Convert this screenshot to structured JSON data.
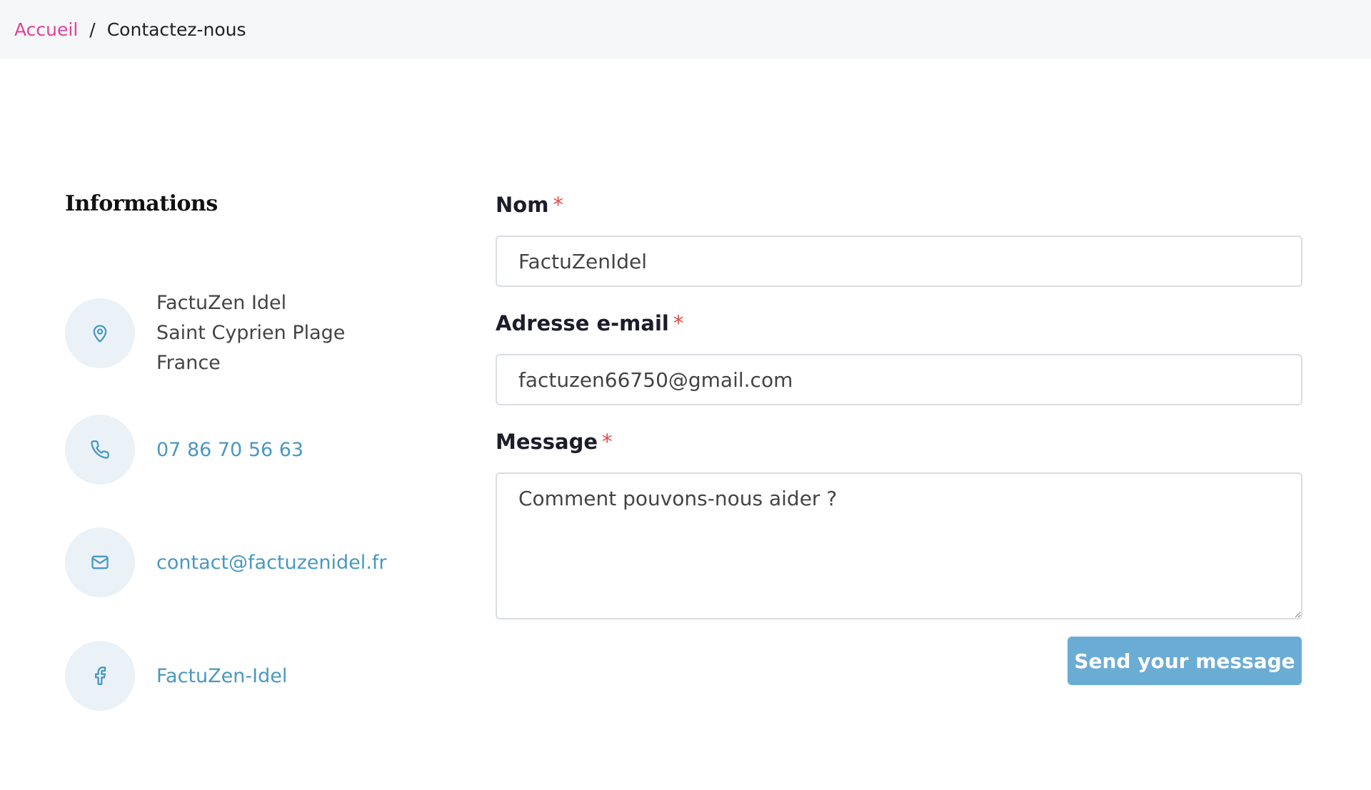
{
  "breadcrumb": {
    "home_label": "Accueil",
    "separator": "/",
    "current_label": "Contactez-nous"
  },
  "info": {
    "title": "Informations",
    "address": {
      "icon": "map-pin-icon",
      "lines": [
        "FactuZen Idel",
        "Saint Cyprien Plage",
        "France"
      ]
    },
    "phone": {
      "icon": "phone-icon",
      "label": "07 86 70 56 63"
    },
    "email": {
      "icon": "mail-icon",
      "label": "contact@factuzenidel.fr"
    },
    "facebook": {
      "icon": "facebook-icon",
      "label": "FactuZen-Idel"
    }
  },
  "form": {
    "required_mark": "*",
    "name": {
      "label": "Nom",
      "value": "FactuZenIdel"
    },
    "email": {
      "label": "Adresse e-mail",
      "value": "factuzen66750@gmail.com"
    },
    "message": {
      "label": "Message",
      "placeholder": "Comment pouvons-nous aider ?"
    },
    "submit_label": "Send your message"
  },
  "colors": {
    "accent_pink": "#e2409a",
    "link_blue": "#4a98c0",
    "button_blue": "#6bacd5",
    "icon_circle_bg": "#eaf2f8",
    "required_red": "#e24b4b"
  }
}
